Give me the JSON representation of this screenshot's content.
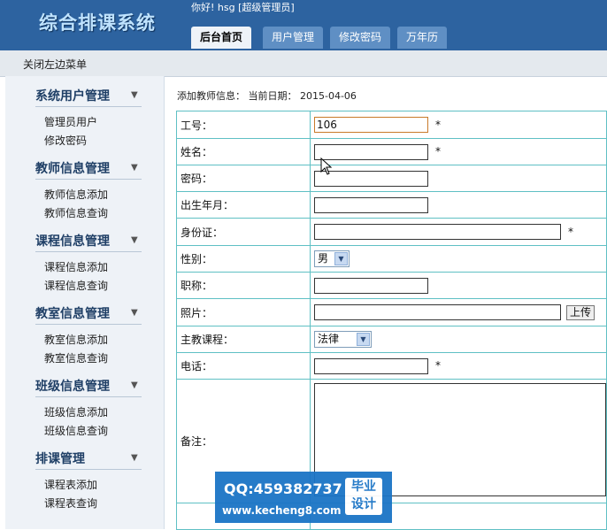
{
  "app": {
    "title": "综合排课系统",
    "greeting": "你好! hsg [超级管理员]"
  },
  "tabs": [
    {
      "label": "后台首页",
      "active": true
    },
    {
      "label": "用户管理",
      "active": false
    },
    {
      "label": "修改密码",
      "active": false
    },
    {
      "label": "万年历",
      "active": false
    }
  ],
  "strip": {
    "close_menu": "关闭左边菜单"
  },
  "sidebar": {
    "sections": [
      {
        "title": "系统用户管理",
        "items": [
          "管理员用户",
          "修改密码"
        ]
      },
      {
        "title": "教师信息管理",
        "items": [
          "教师信息添加",
          "教师信息查询"
        ]
      },
      {
        "title": "课程信息管理",
        "items": [
          "课程信息添加",
          "课程信息查询"
        ]
      },
      {
        "title": "教室信息管理",
        "items": [
          "教室信息添加",
          "教室信息查询"
        ]
      },
      {
        "title": "班级信息管理",
        "items": [
          "班级信息添加",
          "班级信息查询"
        ]
      },
      {
        "title": "排课管理",
        "items": [
          "课程表添加",
          "课程表查询"
        ]
      }
    ],
    "arrow_glyph": "▼"
  },
  "main": {
    "breadcrumb": "添加教师信息： 当前日期： 2015-04-06",
    "fields": {
      "id": {
        "label": "工号：",
        "value": "106",
        "required": "*"
      },
      "name": {
        "label": "姓名：",
        "value": "",
        "required": "*"
      },
      "password": {
        "label": "密码：",
        "value": ""
      },
      "birth": {
        "label": "出生年月：",
        "value": ""
      },
      "idcard": {
        "label": "身份证：",
        "value": "",
        "required": "*"
      },
      "gender": {
        "label": "性别：",
        "selected": "男"
      },
      "title": {
        "label": "职称：",
        "value": ""
      },
      "photo": {
        "label": "照片：",
        "value": "",
        "upload": "上传"
      },
      "course": {
        "label": "主教课程：",
        "selected": "法律"
      },
      "phone": {
        "label": "电话：",
        "value": "",
        "required": "*"
      },
      "remark": {
        "label": "备注：",
        "value": ""
      }
    }
  },
  "watermark": {
    "qq": "QQ:459382737",
    "url": "www.kecheng8.com",
    "badge_line1": "毕业",
    "badge_line2": "设计"
  },
  "colors": {
    "header": "#2d63a0",
    "table_border": "#5fc0c4",
    "sidebar_title": "#1f3f66"
  }
}
